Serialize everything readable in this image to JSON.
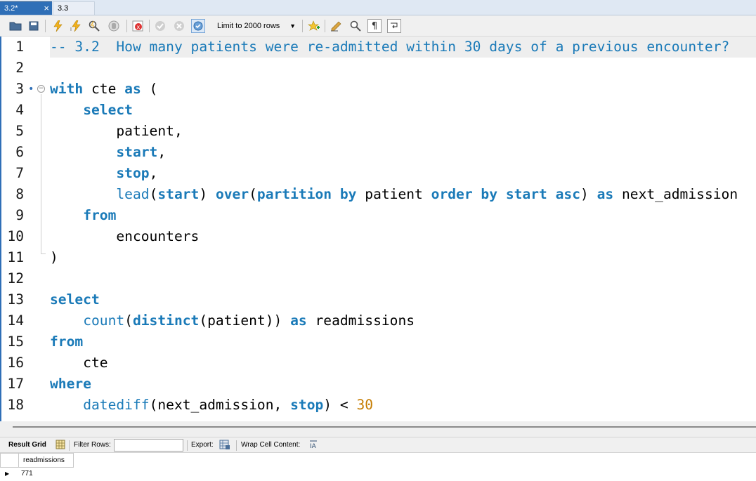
{
  "tabs": [
    {
      "label": "3.2*",
      "close": "×",
      "active": true
    },
    {
      "label": "3.3",
      "active": false
    }
  ],
  "toolbar": {
    "limit_select": "Limit to 2000 rows",
    "icons": [
      "open-folder-icon",
      "save-icon",
      "execute-icon",
      "execute-current-icon",
      "explain-icon",
      "stop-icon",
      "toggle-error-icon",
      "commit-icon",
      "rollback-icon",
      "autocommit-icon",
      "limit-dropdown",
      "add-snippet-icon",
      "beautify-icon",
      "find-icon",
      "invisible-chars-icon",
      "wrap-icon"
    ]
  },
  "editor": {
    "lines": [
      {
        "n": "1",
        "tokens": [
          {
            "t": "-- 3.2  How many patients were re-admitted within 30 days of a previous encounter?",
            "c": "cm"
          }
        ]
      },
      {
        "n": "2",
        "tokens": []
      },
      {
        "n": "3",
        "tokens": [
          {
            "t": "with",
            "c": "kw"
          },
          {
            "t": " cte ",
            "c": "id"
          },
          {
            "t": "as",
            "c": "kw"
          },
          {
            "t": " (",
            "c": "id"
          }
        ]
      },
      {
        "n": "4",
        "tokens": [
          {
            "t": "    ",
            "c": "id"
          },
          {
            "t": "select",
            "c": "kw"
          }
        ]
      },
      {
        "n": "5",
        "tokens": [
          {
            "t": "        patient,",
            "c": "id"
          }
        ]
      },
      {
        "n": "6",
        "tokens": [
          {
            "t": "        ",
            "c": "id"
          },
          {
            "t": "start",
            "c": "kw"
          },
          {
            "t": ",",
            "c": "id"
          }
        ]
      },
      {
        "n": "7",
        "tokens": [
          {
            "t": "        ",
            "c": "id"
          },
          {
            "t": "stop",
            "c": "kw"
          },
          {
            "t": ",",
            "c": "id"
          }
        ]
      },
      {
        "n": "8",
        "tokens": [
          {
            "t": "        ",
            "c": "id"
          },
          {
            "t": "lead",
            "c": "fn"
          },
          {
            "t": "(",
            "c": "id"
          },
          {
            "t": "start",
            "c": "kw"
          },
          {
            "t": ") ",
            "c": "id"
          },
          {
            "t": "over",
            "c": "kw"
          },
          {
            "t": "(",
            "c": "id"
          },
          {
            "t": "partition by",
            "c": "kw"
          },
          {
            "t": " patient ",
            "c": "id"
          },
          {
            "t": "order by",
            "c": "kw"
          },
          {
            "t": " ",
            "c": "id"
          },
          {
            "t": "start",
            "c": "kw"
          },
          {
            "t": " ",
            "c": "id"
          },
          {
            "t": "asc",
            "c": "kw"
          },
          {
            "t": ") ",
            "c": "id"
          },
          {
            "t": "as",
            "c": "kw"
          },
          {
            "t": " next_admission",
            "c": "id"
          }
        ]
      },
      {
        "n": "9",
        "tokens": [
          {
            "t": "    ",
            "c": "id"
          },
          {
            "t": "from",
            "c": "kw"
          }
        ]
      },
      {
        "n": "10",
        "tokens": [
          {
            "t": "        encounters",
            "c": "id"
          }
        ]
      },
      {
        "n": "11",
        "tokens": [
          {
            "t": ")",
            "c": "id"
          }
        ]
      },
      {
        "n": "12",
        "tokens": []
      },
      {
        "n": "13",
        "tokens": [
          {
            "t": "select",
            "c": "kw"
          }
        ]
      },
      {
        "n": "14",
        "tokens": [
          {
            "t": "    ",
            "c": "id"
          },
          {
            "t": "count",
            "c": "fn"
          },
          {
            "t": "(",
            "c": "id"
          },
          {
            "t": "distinct",
            "c": "kw"
          },
          {
            "t": "(patient)) ",
            "c": "id"
          },
          {
            "t": "as",
            "c": "kw"
          },
          {
            "t": " readmissions",
            "c": "id"
          }
        ]
      },
      {
        "n": "15",
        "tokens": [
          {
            "t": "from",
            "c": "kw"
          }
        ]
      },
      {
        "n": "16",
        "tokens": [
          {
            "t": "    cte",
            "c": "id"
          }
        ]
      },
      {
        "n": "17",
        "tokens": [
          {
            "t": "where",
            "c": "kw"
          }
        ]
      },
      {
        "n": "18",
        "tokens": [
          {
            "t": "    ",
            "c": "id"
          },
          {
            "t": "datediff",
            "c": "fn"
          },
          {
            "t": "(next_admission, ",
            "c": "id"
          },
          {
            "t": "stop",
            "c": "kw"
          },
          {
            "t": ") < ",
            "c": "id"
          },
          {
            "t": "30",
            "c": "num"
          }
        ]
      }
    ]
  },
  "results_toolbar": {
    "result_grid": "Result Grid",
    "filter_rows": "Filter Rows:",
    "filter_value": "",
    "export": "Export:",
    "wrap_cell": "Wrap Cell Content:"
  },
  "results": {
    "columns": [
      "readmissions"
    ],
    "rows": [
      [
        "771"
      ]
    ]
  }
}
